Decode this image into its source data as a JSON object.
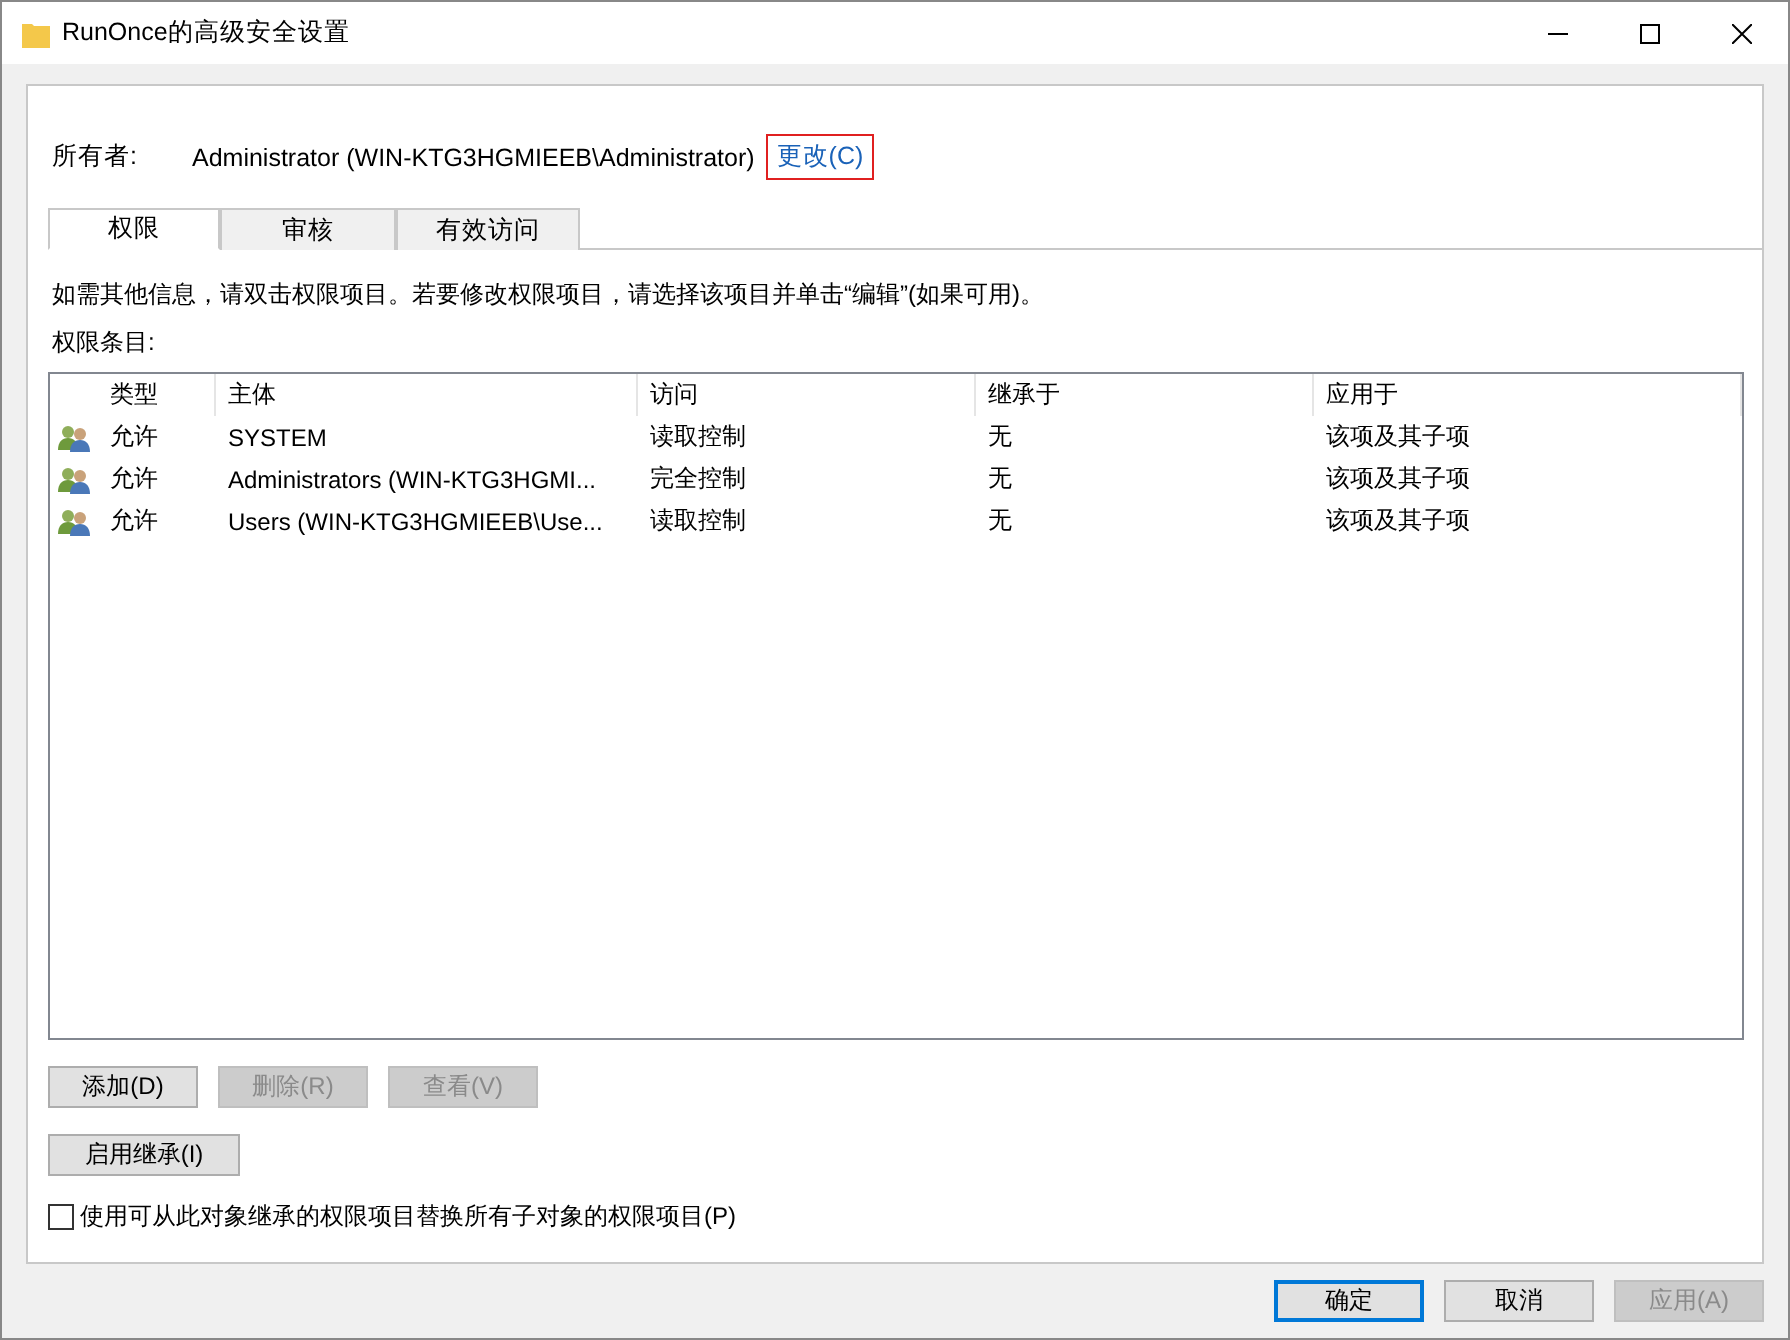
{
  "window": {
    "title": "RunOnce的高级安全设置"
  },
  "owner": {
    "label": "所有者:",
    "value": "Administrator (WIN-KTG3HGMIEEB\\Administrator)",
    "change_link": "更改(C)"
  },
  "tabs": [
    {
      "label": "权限",
      "selected": true
    },
    {
      "label": "审核",
      "selected": false
    },
    {
      "label": "有效访问",
      "selected": false
    }
  ],
  "description": "如需其他信息，请双击权限项目。若要修改权限项目，请选择该项目并单击“编辑”(如果可用)。",
  "list_label": "权限条目:",
  "table": {
    "columns": [
      "类型",
      "主体",
      "访问",
      "继承于",
      "应用于"
    ],
    "rows": [
      {
        "type": "允许",
        "principal": "SYSTEM",
        "access": "读取控制",
        "inherited_from": "无",
        "applies_to": "该项及其子项"
      },
      {
        "type": "允许",
        "principal": "Administrators (WIN-KTG3HGMI...",
        "access": "完全控制",
        "inherited_from": "无",
        "applies_to": "该项及其子项"
      },
      {
        "type": "允许",
        "principal": "Users (WIN-KTG3HGMIEEB\\Use...",
        "access": "读取控制",
        "inherited_from": "无",
        "applies_to": "该项及其子项"
      }
    ]
  },
  "entry_buttons": [
    {
      "label": "添加(D)",
      "disabled": false
    },
    {
      "label": "删除(R)",
      "disabled": true
    },
    {
      "label": "查看(V)",
      "disabled": true
    }
  ],
  "inherit_button": {
    "label": "启用继承(I)",
    "disabled": false
  },
  "replace_checkbox": {
    "label": "使用可从此对象继承的权限项目替换所有子对象的权限项目(P)",
    "checked": false
  },
  "dialog_buttons": [
    {
      "label": "确定",
      "kind": "default",
      "disabled": false
    },
    {
      "label": "取消",
      "kind": "normal",
      "disabled": false
    },
    {
      "label": "应用(A)",
      "kind": "normal",
      "disabled": true
    }
  ]
}
